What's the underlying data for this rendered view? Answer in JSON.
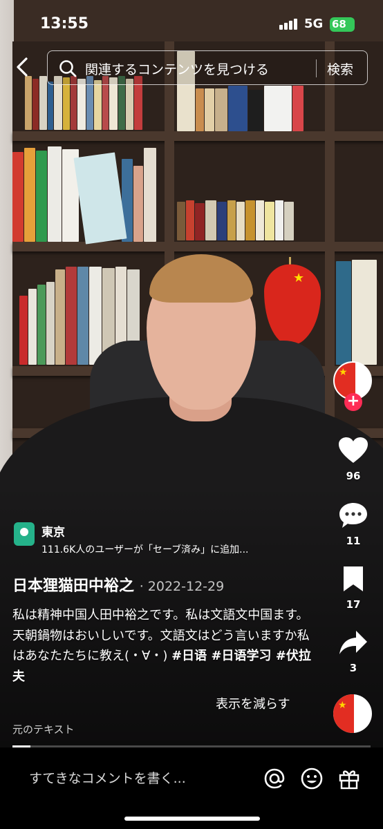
{
  "status_bar": {
    "time": "13:55",
    "network": "5G",
    "battery": "68"
  },
  "search": {
    "placeholder": "関連するコンテンツを見つける",
    "button": "検索"
  },
  "actions": {
    "likes": "96",
    "comments": "11",
    "saves": "17",
    "shares": "3"
  },
  "location": {
    "name": "東京",
    "saved_count": "111.6K人のユーザーが「セーブ済み」に追加..."
  },
  "post": {
    "author": "日本狸猫田中裕之",
    "separator": "·",
    "date": "2022-12-29",
    "caption": "私は精神中国人田中裕之です。私は文語文中国ます。天朝鍋物はおいしいです。文語文はどう言いますか私はあなたたちに教え(・∀・)",
    "hashtags": "#日语 #日语学习 #伏拉夫",
    "show_less": "表示を減らす",
    "original_text": "元のテキスト",
    "progress": 0.05
  },
  "comment_bar": {
    "placeholder": "すてきなコメントを書く..."
  },
  "icons": [
    "back-icon",
    "search-icon",
    "heart-icon",
    "comment-icon",
    "bookmark-icon",
    "share-icon",
    "at-icon",
    "emoji-icon",
    "gift-icon",
    "location-icon",
    "plus-icon"
  ],
  "colors": {
    "follow": "#fe2c55",
    "battery": "#34c759",
    "location": "#25b28a"
  }
}
